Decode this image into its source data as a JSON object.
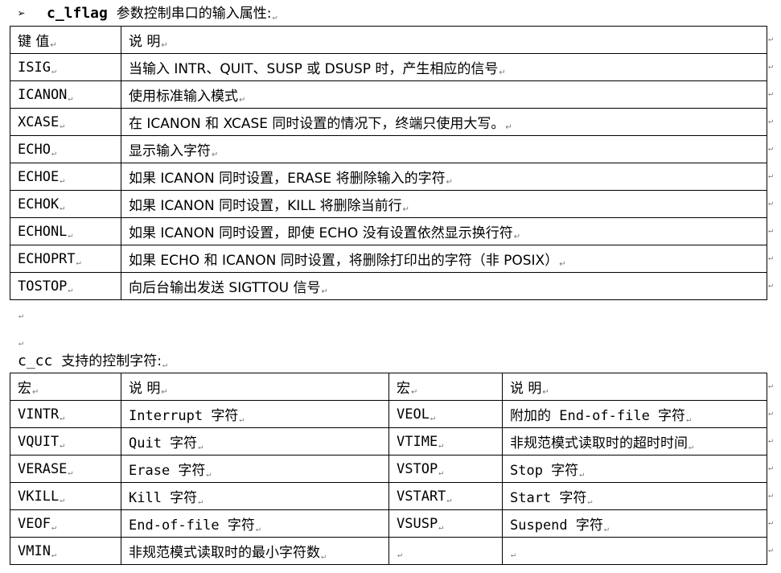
{
  "section1": {
    "bullet": "➢",
    "code": "c_lflag",
    "title": "参数控制串口的输入属性:",
    "headers": {
      "key": "键 值",
      "desc": "说 明"
    },
    "rows": [
      {
        "key": "ISIG",
        "desc": "当输入 INTR、QUIT、SUSP 或 DSUSP 时，产生相应的信号"
      },
      {
        "key": "ICANON",
        "desc": "使用标准输入模式"
      },
      {
        "key": "XCASE",
        "desc": "在 ICANON 和 XCASE 同时设置的情况下，终端只使用大写。"
      },
      {
        "key": "ECHO",
        "desc": "显示输入字符"
      },
      {
        "key": "ECHOE",
        "desc": "如果 ICANON 同时设置，ERASE 将删除输入的字符"
      },
      {
        "key": "ECHOK",
        "desc": "如果 ICANON 同时设置，KILL 将删除当前行"
      },
      {
        "key": "ECHONL",
        "desc": "如果 ICANON 同时设置，即使 ECHO 没有设置依然显示换行符"
      },
      {
        "key": "ECHOPRT",
        "desc": "如果 ECHO 和 ICANON 同时设置，将删除打印出的字符（非 POSIX）"
      },
      {
        "key": "TOSTOP",
        "desc": "向后台输出发送 SIGTTOU 信号"
      }
    ]
  },
  "section2": {
    "code": "c_cc",
    "title": "支持的控制字符:",
    "headers": {
      "macro": "宏",
      "desc": "说 明"
    },
    "rows": [
      {
        "m1": "VINTR",
        "d1": "Interrupt 字符",
        "m2": "VEOL",
        "d2": "附加的 End-of-file 字符"
      },
      {
        "m1": "VQUIT",
        "d1": "Quit 字符",
        "m2": "VTIME",
        "d2": "非规范模式读取时的超时时间"
      },
      {
        "m1": "VERASE",
        "d1": "Erase 字符",
        "m2": "VSTOP",
        "d2": "Stop 字符"
      },
      {
        "m1": "VKILL",
        "d1": "Kill 字符",
        "m2": "VSTART",
        "d2": "Start 字符"
      },
      {
        "m1": "VEOF",
        "d1": "End-of-file 字符",
        "m2": "VSUSP",
        "d2": "Suspend 字符"
      },
      {
        "m1": "VMIN",
        "d1": "非规范模式读取时的最小字符数",
        "m2": "",
        "d2": ""
      }
    ]
  },
  "marks": {
    "paragraph": "↵"
  }
}
